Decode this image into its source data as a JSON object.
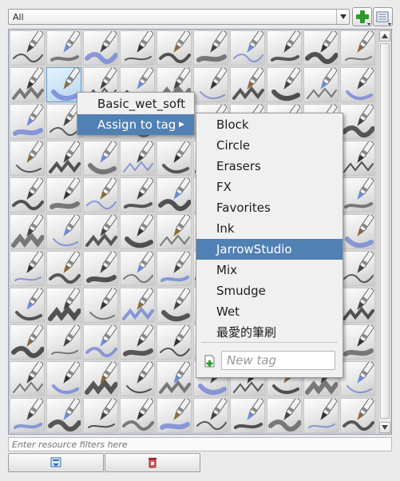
{
  "tag_filter": {
    "selected": "All"
  },
  "filter": {
    "placeholder": "Enter resource filters here"
  },
  "context_menu": {
    "preset_name": "Basic_wet_soft",
    "assign_label": "Assign to tag"
  },
  "tag_submenu": {
    "items": [
      "Block",
      "Circle",
      "Erasers",
      "FX",
      "Favorites",
      "Ink",
      "JarrowStudio",
      "Mix",
      "Smudge",
      "Wet",
      "最愛的筆刷"
    ],
    "highlighted": "JarrowStudio",
    "new_tag_placeholder": "New tag"
  },
  "colors": {
    "highlight": "#5180b3",
    "add_button": "#2e9a2e",
    "frame_border": "#8a9bb3"
  },
  "icons": {
    "add_tag": "plus-icon",
    "view_mode": "list-view-icon",
    "import": "import-resource-icon",
    "delete": "delete-resource-icon",
    "new_tag": "new-tag-icon"
  }
}
